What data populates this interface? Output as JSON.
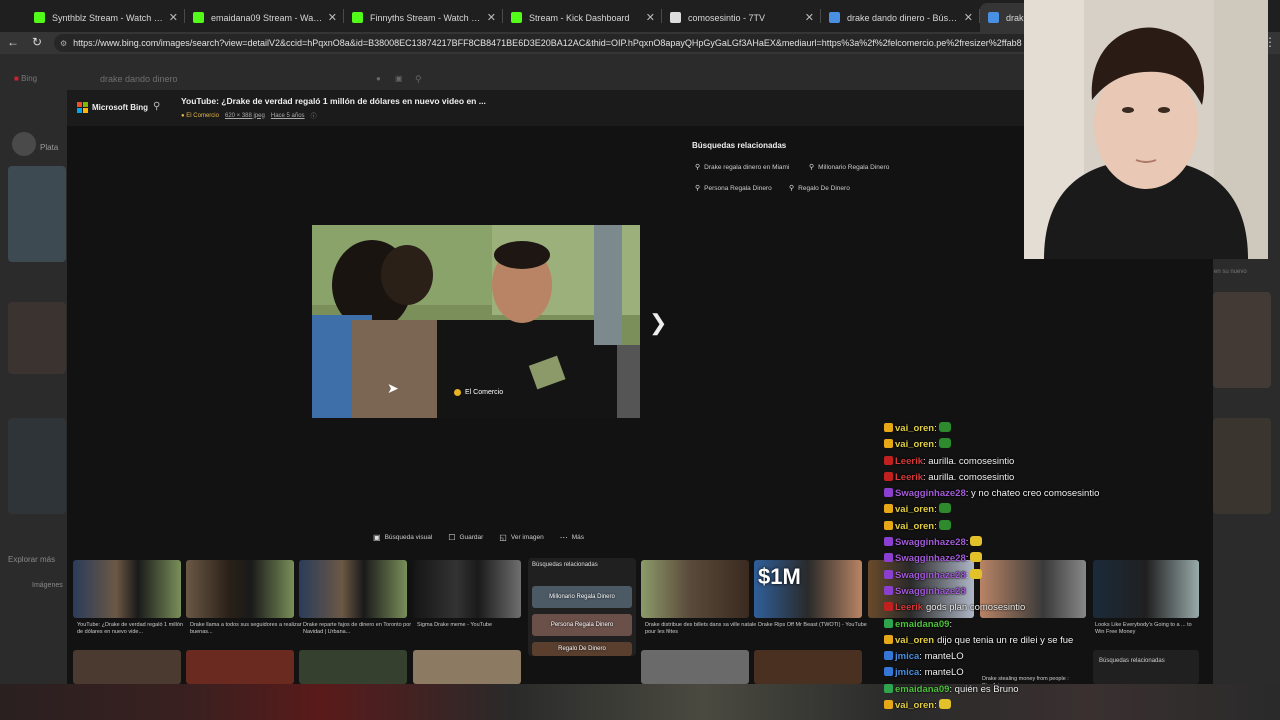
{
  "browser": {
    "tabs": [
      {
        "title": "Synthblz Stream - Watch Live on K",
        "favicon": "kick-icon",
        "color": "#53fc18"
      },
      {
        "title": "emaidana09 Stream - Watch Live o",
        "favicon": "kick-icon",
        "color": "#53fc18"
      },
      {
        "title": "Finnyths Stream - Watch Live on K",
        "favicon": "kick-icon",
        "color": "#53fc18"
      },
      {
        "title": "Stream - Kick Dashboard",
        "favicon": "kick-icon",
        "color": "#53fc18"
      },
      {
        "title": "comosesintio - 7TV",
        "favicon": "7tv-icon",
        "color": "#dddddd"
      },
      {
        "title": "drake dando dinero - Búsqueda",
        "favicon": "search-icon",
        "color": "#4a90e2"
      },
      {
        "title": "drake d",
        "favicon": "bing-icon",
        "color": "#4a90e2"
      }
    ],
    "url": "https://www.bing.com/images/search?view=detailV2&ccid=hPqxnO8a&id=B38008EC13874217BFF8CB8471BE6D3E20BA12AC&thid=OIP.hPqxnO8apayQHpGyGaLGf3AHaEX&mediaurl=https%3a%2f%2felcomercio.pe%2fresizer%2ffab8"
  },
  "page": {
    "search_query": "drake dando dinero",
    "bing_label": "Bing",
    "bg_user_tier": "Plata",
    "bg_explore": "Explorar más",
    "bg_images": "Imágenes"
  },
  "viewer": {
    "brand": "Microsoft Bing",
    "title": "YouTube: ¿Drake de verdad regaló 1 millón de dólares en nuevo video en ...",
    "source": "El Comercio",
    "dimensions": "620 × 388 jpeg",
    "age": "Hace 5 años",
    "image_badge": "El Comercio",
    "related_heading": "Búsquedas relacionadas",
    "related": [
      "Drake regala dinero en Miami",
      "Millonario Regala Dinero",
      "Persona Regala Dinero",
      "Regalo De Dinero"
    ],
    "actions": [
      {
        "label": "Búsqueda visual",
        "icon": "visual-search-icon"
      },
      {
        "label": "Guardar",
        "icon": "save-icon"
      },
      {
        "label": "Ver imagen",
        "icon": "open-image-icon"
      },
      {
        "label": "Más",
        "icon": "more-icon"
      }
    ],
    "thumbnails": [
      {
        "caption": "YouTube: ¿Drake de verdad regaló 1 millón de dólares en nuevo vide..."
      },
      {
        "caption": "Drake llama a todos sus seguidores a realizar buenas..."
      },
      {
        "caption": "Drake reparte fajos de dinero en Toronto por Navidad | Urbana..."
      },
      {
        "caption": "Sigma Drake meme - YouTube"
      },
      {
        "caption": "Drake distribue des billets dans sa ville natale pour les fêtes"
      },
      {
        "caption": "Drake Rips Off Mr Beast (TWOTI) - YouTube"
      },
      {
        "caption": "Drake stealing money from people : PicsArt"
      }
    ],
    "thumb_overlay": "$1M",
    "rel_card": {
      "heading": "Búsquedas relacionadas",
      "pills": [
        "Millonario Regala Dinero",
        "Persona Regala Dinero",
        "Regalo De Dinero"
      ]
    },
    "right_thumb_caption": "Looks Like Everybody's Going to a ... to Win Free Money",
    "right_rel_label": "Búsquedas relacionadas",
    "bg_mid_label": "en su nuevo"
  },
  "chat": {
    "messages": [
      {
        "user": "vai_oren",
        "text": "",
        "color": "yellow",
        "emote": "#2d8a2d"
      },
      {
        "user": "vai_oren",
        "text": "",
        "color": "yellow",
        "emote": "#2d8a2d"
      },
      {
        "user": "Leerik",
        "text": ": aurilla. comosesintio",
        "color": "red",
        "emote": ""
      },
      {
        "user": "Leerik",
        "text": ": aurilla. comosesintio",
        "color": "red",
        "emote": ""
      },
      {
        "user": "Swagginhaze28",
        "text": ": y no chateo creo comosesintio",
        "color": "purple",
        "emote": ""
      },
      {
        "user": "vai_oren",
        "text": "",
        "color": "yellow",
        "emote": "#2d8a2d"
      },
      {
        "user": "vai_oren",
        "text": "",
        "color": "yellow",
        "emote": "#2d8a2d"
      },
      {
        "user": "Swagginhaze28",
        "text": "",
        "color": "purple",
        "emote": "#e3c12a"
      },
      {
        "user": "Swagginhaze28",
        "text": "",
        "color": "purple",
        "emote": "#e3c12a"
      },
      {
        "user": "Swagginhaze28",
        "text": "",
        "color": "purple",
        "emote": "#e3c12a"
      },
      {
        "user": "Swagginhaze28",
        "text": "",
        "color": "purple",
        "emote": ""
      },
      {
        "user": "Leerik",
        "text": "gods plan comosesintio",
        "color": "red",
        "emote": ""
      },
      {
        "user": "emaidana09",
        "text": ":",
        "color": "green",
        "emote": ""
      },
      {
        "user": "vai_oren",
        "text": "dijo que tenia un re dilei y se fue",
        "color": "yellow",
        "emote": ""
      },
      {
        "user": "jmica",
        "text": ": manteLO",
        "color": "blue",
        "emote": ""
      },
      {
        "user": "jmica",
        "text": ": manteLO",
        "color": "blue",
        "emote": ""
      },
      {
        "user": "emaidana09",
        "text": ": quién es Bruno",
        "color": "green",
        "emote": ""
      },
      {
        "user": "vai_oren",
        "text": "",
        "color": "yellow",
        "emote": "#e3c12a"
      }
    ]
  }
}
